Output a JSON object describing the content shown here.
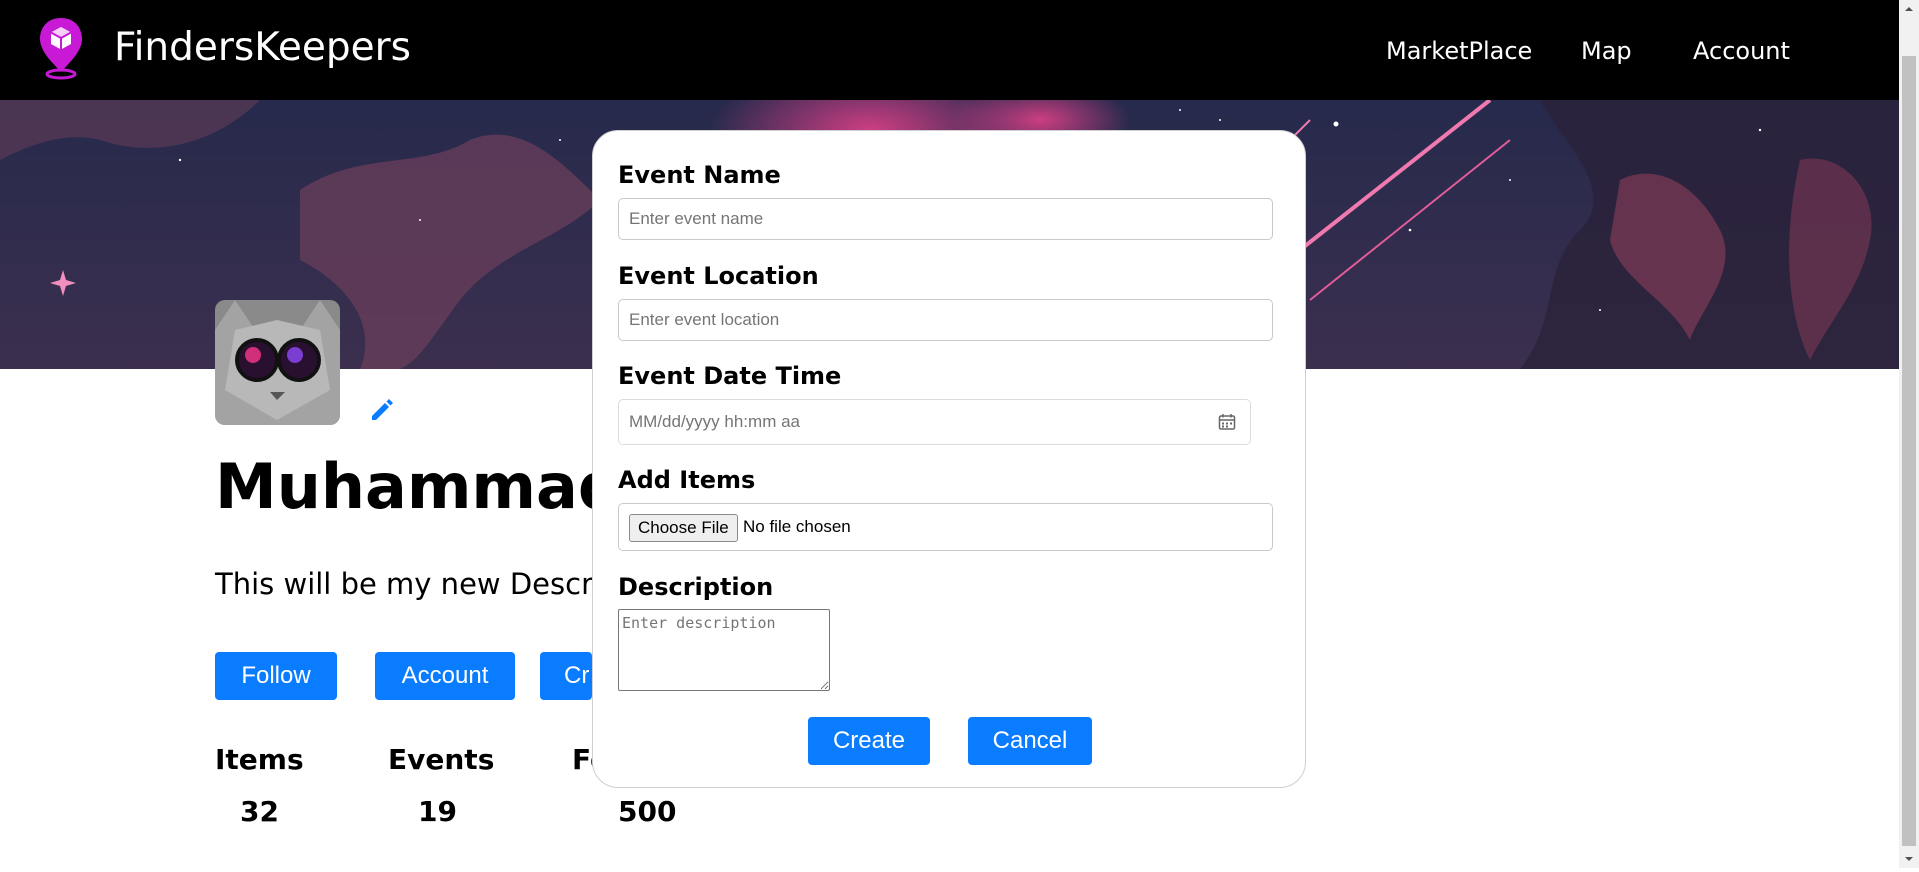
{
  "navbar": {
    "brand": "FindersKeepers",
    "links": [
      "MarketPlace",
      "Map",
      "Account"
    ]
  },
  "profile": {
    "name": "Muhammad A",
    "description": "This will be my new Descripti",
    "buttons": [
      "Follow",
      "Account",
      "Cr"
    ],
    "stats": [
      {
        "label": "Items",
        "value": "32"
      },
      {
        "label": "Events",
        "value": "19"
      },
      {
        "label": "Fo",
        "value": "500"
      }
    ]
  },
  "modal": {
    "event_name_label": "Event Name",
    "event_name_placeholder": "Enter event name",
    "event_location_label": "Event Location",
    "event_location_placeholder": "Enter event location",
    "event_datetime_label": "Event Date Time",
    "event_datetime_placeholder": "MM/dd/yyyy hh:mm aa",
    "add_items_label": "Add Items",
    "choose_file_label": "Choose File",
    "file_status": "No file chosen",
    "description_label": "Description",
    "description_placeholder": "Enter description",
    "create_label": "Create",
    "cancel_label": "Cancel"
  },
  "colors": {
    "accent": "#0a7cff",
    "navbar": "#000000",
    "logo": "#c81ad6"
  },
  "icons": [
    "location-cube-logo-icon",
    "pencil-icon",
    "calendar-icon",
    "arrow-up-icon",
    "arrow-down-icon"
  ]
}
